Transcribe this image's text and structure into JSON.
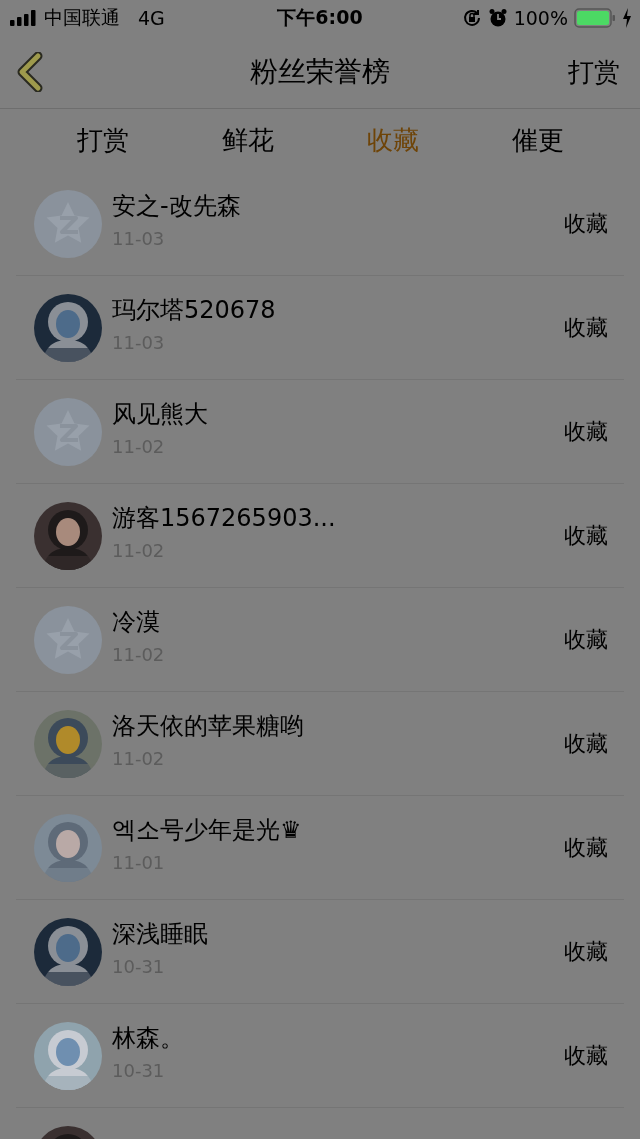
{
  "status_bar": {
    "carrier": "中国联通",
    "network": "4G",
    "time": "下午6:00",
    "battery_percent": "100%"
  },
  "nav": {
    "title": "粉丝荣誉榜",
    "action": "打赏"
  },
  "tabs": [
    {
      "label": "打赏",
      "selected": false
    },
    {
      "label": "鲜花",
      "selected": false
    },
    {
      "label": "收藏",
      "selected": true
    },
    {
      "label": "催更",
      "selected": false
    }
  ],
  "fans": [
    {
      "kind": "default",
      "name": "安之-改先森",
      "date": "11-03",
      "action": "收藏"
    },
    {
      "kind": "picture",
      "name": "玛尔塔520678",
      "date": "11-03",
      "action": "收藏"
    },
    {
      "kind": "default",
      "name": "风见熊大",
      "date": "11-02",
      "action": "收藏"
    },
    {
      "kind": "picture",
      "name": "游客1567265903...",
      "date": "11-02",
      "action": "收藏"
    },
    {
      "kind": "default",
      "name": "冷漠",
      "date": "11-02",
      "action": "收藏"
    },
    {
      "kind": "picture",
      "name": "洛天依的苹果糖哟",
      "date": "11-02",
      "action": "收藏"
    },
    {
      "kind": "picture",
      "name": "엑소号少年是光♛",
      "date": "11-01",
      "action": "收藏"
    },
    {
      "kind": "picture",
      "name": "深浅睡眠",
      "date": "10-31",
      "action": "收藏"
    },
    {
      "kind": "picture",
      "name": "林森。",
      "date": "10-31",
      "action": "收藏"
    },
    {
      "kind": "picture"
    }
  ]
}
